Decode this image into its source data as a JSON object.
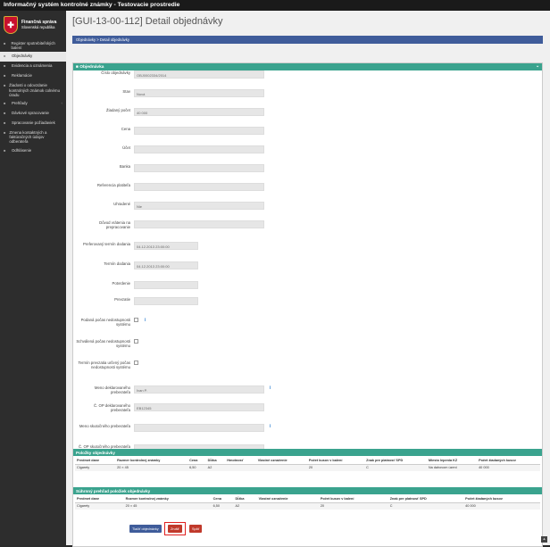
{
  "app_title": "Informačný systém kontrolné známky - Testovacie prostredie",
  "logo": {
    "line1": "Finančná správa",
    "line2": "Slovenská republika",
    "emblem": "✚"
  },
  "nav": [
    {
      "label": "Register spotrebiteľských balení",
      "icon": "list-icon"
    },
    {
      "label": "Objednávky",
      "icon": "cart-icon",
      "active": true
    },
    {
      "label": "Evidencia a oznámenia",
      "icon": "edit-icon"
    },
    {
      "label": "Reklamácie",
      "icon": "warning-icon"
    },
    {
      "label": "Žiadosti o odovzdanie kontrolných známok colnému úradu",
      "icon": "doc-icon"
    },
    {
      "label": "Prehľady",
      "icon": "table-icon",
      "chevron": "‹"
    },
    {
      "label": "Dávkové spracovanie",
      "icon": "gear-icon"
    },
    {
      "label": "Spracovanie požiadaviek",
      "icon": "flag-icon"
    },
    {
      "label": "Zmena kontaktných a faktúračných údajov odberateľa",
      "icon": "person-icon"
    },
    {
      "label": "Odhlásenie",
      "icon": "logout-icon"
    }
  ],
  "page_title": "[GUI-13-00-112] Detail objednávky",
  "breadcrumb": "Objednávky  >  Detail objednávky",
  "panel_title": "Objednávka",
  "form": [
    {
      "label": "Číslo objednávky",
      "value": "OBJ0002334/2014"
    },
    {
      "label": "Stav",
      "value": "Nová"
    },
    {
      "label": "Žiadaný počet",
      "value": "40 000"
    },
    {
      "label": "Cena",
      "value": ""
    },
    {
      "label": "Účet",
      "value": ""
    },
    {
      "label": "Banka",
      "value": ""
    },
    {
      "label": "Referencia platiteľa",
      "value": ""
    },
    {
      "label": "Uhradené",
      "value": "Nie"
    },
    {
      "label": "Dôvod vrátenia na prepracovanie",
      "value": ""
    },
    {
      "label": "Preferovaný termín dodania",
      "value": "04.12.2013 23:00:00"
    },
    {
      "label": "Termín dodania",
      "value": "04.12.2013 23:00:00"
    },
    {
      "label": "Potvrdenie",
      "value": ""
    },
    {
      "label": "Prevzatie",
      "value": ""
    },
    {
      "label": "Podaná počas nedostupnosti systému",
      "value": ""
    },
    {
      "label": "Schválená počas nedostupnosti systému",
      "value": ""
    },
    {
      "label": "Termín prevzatia určený počas nedostupnosti systému",
      "value": ""
    },
    {
      "label": "Meno deklarovaného preberateľa",
      "value": "Ivan P."
    },
    {
      "label": "Č. OP deklarovaného preberateľa",
      "value": "EB12345"
    },
    {
      "label": "Meno skutočného preberateľa",
      "value": ""
    },
    {
      "label": "Č. OP skutočného preberateľa",
      "value": ""
    }
  ],
  "items": {
    "title": "Položky objednávky",
    "headers": [
      "Predmet dane",
      "Rozmer kontrolnej známky",
      "Cena",
      "Dĺžka",
      "Hmotnosť",
      "Vlastné označenie",
      "Počet kusov v balení",
      "Znak pre platnosť SPD",
      "Miesto lepenia KZ",
      "Počet žiadaných kusov"
    ],
    "rows": [
      [
        "Cigarety",
        "20 × 45",
        "6,50",
        "A2",
        "",
        "",
        "20",
        "C",
        "Na dahovom úzeni",
        "40 000"
      ]
    ]
  },
  "summary": {
    "title": "Súhrnný prehľad položiek objednávky",
    "headers": [
      "Predmet dane",
      "Rozmer kontrolnej známky",
      "Cena",
      "Dĺžka",
      "Vlastné označenie",
      "Počet kusov v balení",
      "Znak pre platnosť SPD",
      "Počet žiadaných kusov"
    ],
    "rows": [
      [
        "Cigarety",
        "20 × 45",
        "6,50",
        "A2",
        "",
        "20",
        "C",
        "40 000"
      ]
    ]
  },
  "buttons": {
    "print": "Tlačiť objednávky",
    "cancel": "Zrušiť",
    "back": "Späť"
  },
  "info_icon": "i",
  "panel_chevron": "⌄",
  "corner_icon": "▲"
}
